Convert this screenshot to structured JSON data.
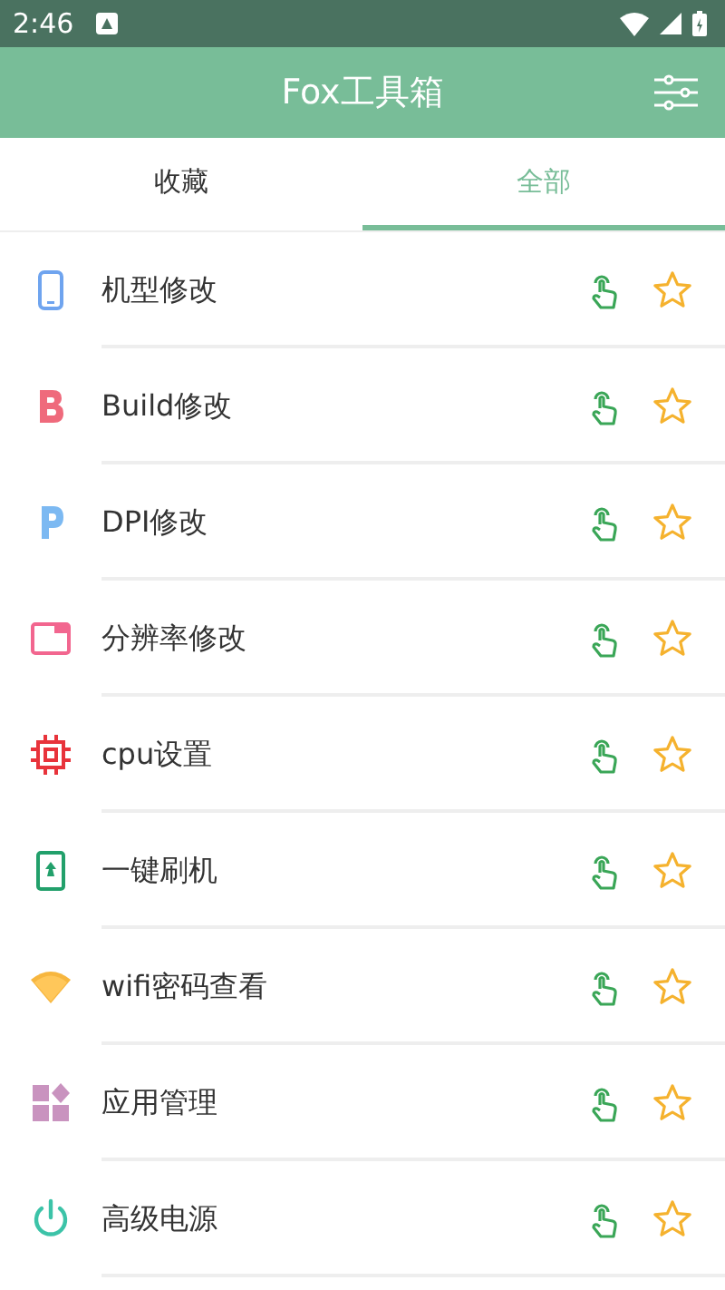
{
  "status_bar": {
    "time": "2:46"
  },
  "app_bar": {
    "title": "Fox工具箱"
  },
  "tabs": [
    {
      "label": "收藏",
      "selected": false
    },
    {
      "label": "全部",
      "selected": true
    }
  ],
  "items": [
    {
      "label": "机型修改",
      "kind": "phone",
      "favorite": false
    },
    {
      "label": "Build修改",
      "kind": "letter-b",
      "favorite": false
    },
    {
      "label": "DPI修改",
      "kind": "letter-p",
      "favorite": false
    },
    {
      "label": "分辨率修改",
      "kind": "window",
      "favorite": false
    },
    {
      "label": "cpu设置",
      "kind": "chip",
      "favorite": false
    },
    {
      "label": "一键刷机",
      "kind": "flash",
      "favorite": false
    },
    {
      "label": "wifi密码查看",
      "kind": "wifi",
      "favorite": false
    },
    {
      "label": "应用管理",
      "kind": "apps",
      "favorite": false
    },
    {
      "label": "高级电源",
      "kind": "power",
      "favorite": false
    }
  ]
}
